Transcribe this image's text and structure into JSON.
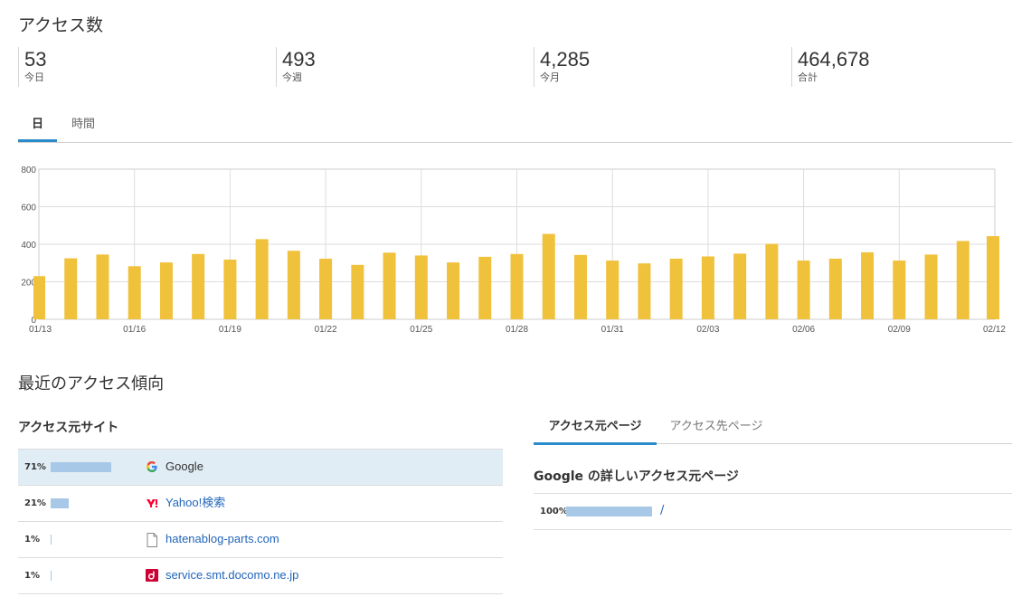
{
  "page_title": "アクセス数",
  "stats": [
    {
      "value": "53",
      "label": "今日"
    },
    {
      "value": "493",
      "label": "今週"
    },
    {
      "value": "4,285",
      "label": "今月"
    },
    {
      "value": "464,678",
      "label": "合計"
    }
  ],
  "period_tabs": [
    {
      "label": "日",
      "active": true
    },
    {
      "label": "時間",
      "active": false
    }
  ],
  "chart_data": {
    "type": "bar",
    "ylim": [
      0,
      800
    ],
    "y_ticks": [
      "800",
      "600",
      "400",
      "200",
      "0"
    ],
    "x_tick_labels": [
      "01/13",
      "01/16",
      "01/19",
      "01/22",
      "01/25",
      "01/28",
      "01/31",
      "02/03",
      "02/06",
      "02/09",
      "02/12"
    ],
    "categories": [
      "01/13",
      "01/14",
      "01/15",
      "01/16",
      "01/17",
      "01/18",
      "01/19",
      "01/20",
      "01/21",
      "01/22",
      "01/23",
      "01/24",
      "01/25",
      "01/26",
      "01/27",
      "01/28",
      "01/29",
      "01/30",
      "01/31",
      "02/01",
      "02/02",
      "02/03",
      "02/04",
      "02/05",
      "02/06",
      "02/07",
      "02/08",
      "02/09",
      "02/10",
      "02/11",
      "02/12"
    ],
    "values": [
      230,
      325,
      345,
      283,
      303,
      348,
      318,
      427,
      365,
      323,
      290,
      355,
      340,
      303,
      333,
      348,
      455,
      343,
      313,
      298,
      323,
      335,
      350,
      402,
      313,
      323,
      357,
      313,
      345,
      417,
      443
    ],
    "bar_color": "#f0c13a",
    "grid": true
  },
  "trend_title": "最近のアクセス傾向",
  "referrers": {
    "title": "アクセス元サイト",
    "rows": [
      {
        "pct": "71%",
        "share": 0.71,
        "icon": "google-icon",
        "site": "Google",
        "selected": true,
        "link": false
      },
      {
        "pct": "21%",
        "share": 0.21,
        "icon": "yahoo-icon",
        "site": "Yahoo!検索",
        "selected": false,
        "link": true
      },
      {
        "pct": "1%",
        "share": 0.01,
        "icon": "document-icon",
        "site": "hatenablog-parts.com",
        "selected": false,
        "link": true
      },
      {
        "pct": "1%",
        "share": 0.01,
        "icon": "docomo-icon",
        "site": "service.smt.docomo.ne.jp",
        "selected": false,
        "link": true
      }
    ]
  },
  "page_tabs": [
    {
      "label": "アクセス元ページ",
      "active": true
    },
    {
      "label": "アクセス先ページ",
      "active": false
    }
  ],
  "detail": {
    "title": "Google の詳しいアクセス元ページ",
    "rows": [
      {
        "pct": "100%",
        "share": 1.0,
        "path": "/"
      }
    ]
  },
  "colors": {
    "accent": "#2b8ccc",
    "bar": "#f0c13a",
    "ref_bar": "#a8c8e8",
    "selected_row": "#e1edf5",
    "link": "#2266bb"
  }
}
